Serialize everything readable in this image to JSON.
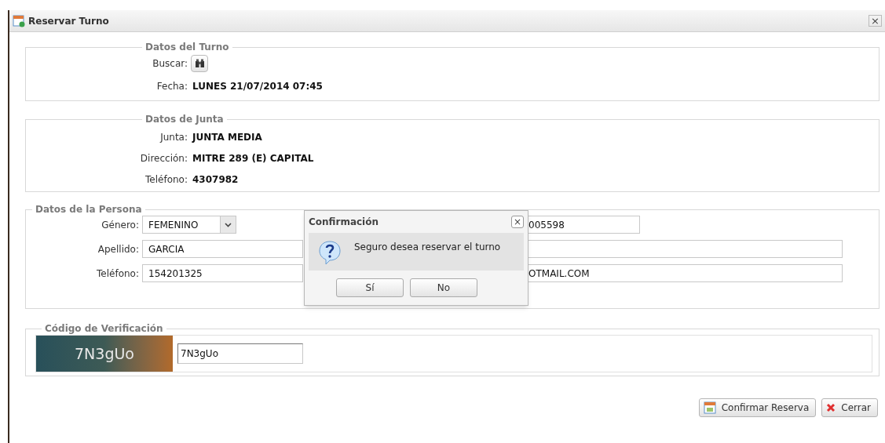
{
  "window": {
    "title": "Reservar Turno",
    "close": "×"
  },
  "turno": {
    "legend": "Datos del Turno",
    "search_label": "Buscar:",
    "fecha_label": "Fecha:",
    "fecha": "LUNES 21/07/2014 07:45"
  },
  "junta": {
    "legend": "Datos de Junta",
    "rows": [
      {
        "label": "Junta:",
        "value": "JUNTA MEDIA"
      },
      {
        "label": "Dirección:",
        "value": "MITRE 289 (E) CAPITAL"
      },
      {
        "label": "Teléfono:",
        "value": "4307982"
      }
    ]
  },
  "persona": {
    "legend": "Datos de la Persona",
    "rows": [
      {
        "label": "Género:",
        "kind": "select",
        "value": "FEMENINO",
        "right": {
          "kind": "short",
          "value": "005598"
        }
      },
      {
        "label": "Apellido:",
        "kind": "text",
        "value": "GARCIA",
        "right": {
          "kind": "long"
        }
      },
      {
        "label": "Teléfono:",
        "kind": "text",
        "value": "154201325",
        "right": {
          "kind": "long",
          "value": "OTMAIL.COM"
        }
      }
    ]
  },
  "verificacion": {
    "legend": "Código de Verificación",
    "captcha": "7N3gUo",
    "value": "7N3gUo"
  },
  "buttons": [
    {
      "label": "Confirmar Reserva",
      "kind": "confirm"
    },
    {
      "label": "Cerrar",
      "kind": "close"
    }
  ],
  "dialog": {
    "title": "Confirmación",
    "close": "×",
    "message": "Seguro desea reservar el turno",
    "buttons": [
      "Sí",
      "No"
    ]
  }
}
